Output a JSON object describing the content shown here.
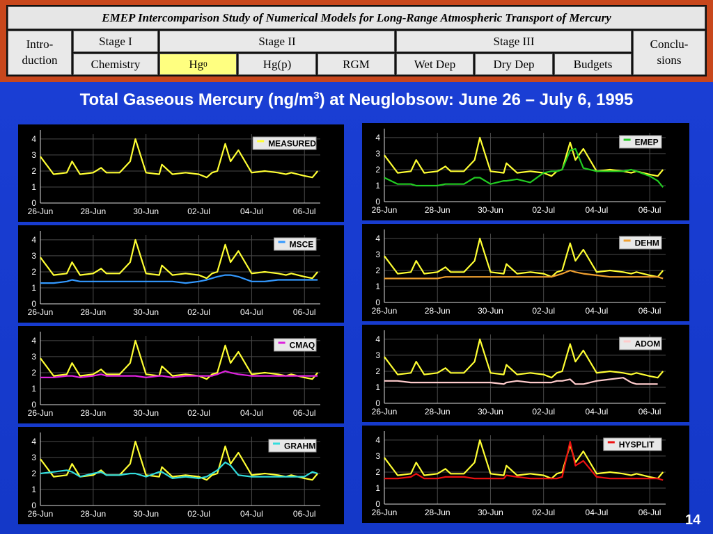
{
  "nav": {
    "title": "EMEP Intercomparison Study of Numerical Models for Long-Range Atmospheric Transport of Mercury",
    "intro": "Intro-\nduction",
    "stage1": "Stage I",
    "stage2": "Stage II",
    "stage3": "Stage III",
    "conclusions": "Conclu-\nsions",
    "chemistry": "Chemistry",
    "hg0_base": "Hg",
    "hg0_sup": "0",
    "hgp": "Hg(p)",
    "rgm": "RGM",
    "wetdep": "Wet Dep",
    "drydep": "Dry Dep",
    "budgets": "Budgets"
  },
  "title": {
    "prefix": "Total Gaseous Mercury (ng/m",
    "sup": "3",
    "suffix": ") at Neuglobsow: June 26 – July 6, 1995"
  },
  "page_number": "14",
  "colors": {
    "measured": "#ffff33",
    "emep": "#22cc22",
    "msce": "#3399ff",
    "dehm": "#f0a030",
    "cmaq": "#dd22dd",
    "adom": "#ffcccc",
    "grahm": "#33dddd",
    "hysplit": "#ee1111",
    "nav_active": "#ffff80",
    "background": "#1b3fd6"
  },
  "chart_data": [
    {
      "type": "line",
      "title": "",
      "x_tick_labels": [
        "26-Jun",
        "28-Jun",
        "30-Jun",
        "02-Jul",
        "04-Jul",
        "06-Jul"
      ],
      "x": [
        26.0,
        26.5,
        27.0,
        27.2,
        27.5,
        28.0,
        28.3,
        28.5,
        29.0,
        29.4,
        29.6,
        30.0,
        30.5,
        30.6,
        31.0,
        31.5,
        32.0,
        32.3,
        32.5,
        32.7,
        33.0,
        33.2,
        33.5,
        34.0,
        34.5,
        35.0,
        35.3,
        35.5,
        36.0,
        36.3,
        36.5
      ],
      "y_ticks": [
        0,
        1,
        2,
        3,
        4
      ],
      "ylim": [
        0,
        4.3
      ],
      "grid": true,
      "legend_position": "top-right",
      "series": [
        {
          "name": "MEASURED",
          "color_key": "measured",
          "values": [
            2.9,
            1.8,
            1.9,
            2.6,
            1.8,
            1.9,
            2.2,
            1.9,
            1.9,
            2.6,
            4.0,
            1.9,
            1.8,
            2.4,
            1.8,
            1.9,
            1.8,
            1.6,
            1.9,
            2.0,
            3.7,
            2.6,
            3.3,
            1.9,
            2.0,
            1.9,
            1.8,
            1.9,
            1.7,
            1.6,
            2.0
          ]
        }
      ]
    },
    {
      "type": "line",
      "title": "",
      "x_tick_labels": [
        "26-Jun",
        "28-Jun",
        "30-Jun",
        "02-Jul",
        "04-Jul",
        "06-Jul"
      ],
      "x": [
        26.0,
        26.5,
        27.0,
        27.2,
        27.5,
        28.0,
        28.3,
        28.5,
        29.0,
        29.4,
        29.6,
        30.0,
        30.5,
        30.6,
        31.0,
        31.5,
        32.0,
        32.3,
        32.5,
        32.7,
        33.0,
        33.2,
        33.5,
        34.0,
        34.5,
        35.0,
        35.3,
        35.5,
        36.0,
        36.3,
        36.5
      ],
      "y_ticks": [
        0,
        1,
        2,
        3,
        4
      ],
      "ylim": [
        0,
        4.3
      ],
      "grid": true,
      "legend_position": "top-right",
      "series": [
        {
          "name": "MEASURED",
          "color_key": "measured",
          "values": [
            2.9,
            1.8,
            1.9,
            2.6,
            1.8,
            1.9,
            2.2,
            1.9,
            1.9,
            2.6,
            4.0,
            1.9,
            1.8,
            2.4,
            1.8,
            1.9,
            1.8,
            1.6,
            1.9,
            2.0,
            3.7,
            2.6,
            3.3,
            1.9,
            2.0,
            1.9,
            1.8,
            1.9,
            1.7,
            1.6,
            2.0
          ]
        },
        {
          "name": "EMEP",
          "color_key": "emep",
          "values": [
            1.5,
            1.1,
            1.1,
            1.0,
            1.0,
            1.0,
            1.1,
            1.1,
            1.1,
            1.5,
            1.5,
            1.1,
            1.3,
            1.3,
            1.4,
            1.2,
            1.8,
            1.9,
            1.9,
            2.0,
            3.2,
            3.3,
            2.1,
            1.9,
            1.9,
            1.9,
            2.0,
            1.9,
            1.6,
            1.3,
            0.9
          ]
        }
      ]
    },
    {
      "type": "line",
      "title": "",
      "x_tick_labels": [
        "26-Jun",
        "28-Jun",
        "30-Jun",
        "02-Jul",
        "04-Jul",
        "06-Jul"
      ],
      "x": [
        26.0,
        26.5,
        27.0,
        27.2,
        27.5,
        28.0,
        28.3,
        28.5,
        29.0,
        29.4,
        29.6,
        30.0,
        30.5,
        30.6,
        31.0,
        31.5,
        32.0,
        32.3,
        32.5,
        32.7,
        33.0,
        33.2,
        33.5,
        34.0,
        34.5,
        35.0,
        35.3,
        35.5,
        36.0,
        36.3,
        36.5
      ],
      "y_ticks": [
        0,
        1,
        2,
        3,
        4
      ],
      "ylim": [
        0,
        4.3
      ],
      "grid": true,
      "legend_position": "top-right",
      "series": [
        {
          "name": "MEASURED",
          "color_key": "measured",
          "values": [
            2.9,
            1.8,
            1.9,
            2.6,
            1.8,
            1.9,
            2.2,
            1.9,
            1.9,
            2.6,
            4.0,
            1.9,
            1.8,
            2.4,
            1.8,
            1.9,
            1.8,
            1.6,
            1.9,
            2.0,
            3.7,
            2.6,
            3.3,
            1.9,
            2.0,
            1.9,
            1.8,
            1.9,
            1.7,
            1.6,
            2.0
          ]
        },
        {
          "name": "MSCE",
          "color_key": "msce",
          "values": [
            1.3,
            1.3,
            1.4,
            1.5,
            1.4,
            1.4,
            1.4,
            1.4,
            1.4,
            1.4,
            1.4,
            1.4,
            1.4,
            1.4,
            1.4,
            1.3,
            1.4,
            1.5,
            1.6,
            1.7,
            1.8,
            1.8,
            1.7,
            1.4,
            1.4,
            1.5,
            1.5,
            1.5,
            1.5,
            1.5,
            1.5
          ]
        }
      ]
    },
    {
      "type": "line",
      "title": "",
      "x_tick_labels": [
        "26-Jun",
        "28-Jun",
        "30-Jun",
        "02-Jul",
        "04-Jul",
        "06-Jul"
      ],
      "x": [
        26.0,
        26.5,
        27.0,
        27.2,
        27.5,
        28.0,
        28.3,
        28.5,
        29.0,
        29.4,
        29.6,
        30.0,
        30.5,
        30.6,
        31.0,
        31.5,
        32.0,
        32.3,
        32.5,
        32.7,
        33.0,
        33.2,
        33.5,
        34.0,
        34.5,
        35.0,
        35.3,
        35.5,
        36.0,
        36.3,
        36.5
      ],
      "y_ticks": [
        0,
        1,
        2,
        3,
        4
      ],
      "ylim": [
        0,
        4.3
      ],
      "grid": true,
      "legend_position": "top-right",
      "series": [
        {
          "name": "MEASURED",
          "color_key": "measured",
          "values": [
            2.9,
            1.8,
            1.9,
            2.6,
            1.8,
            1.9,
            2.2,
            1.9,
            1.9,
            2.6,
            4.0,
            1.9,
            1.8,
            2.4,
            1.8,
            1.9,
            1.8,
            1.6,
            1.9,
            2.0,
            3.7,
            2.6,
            3.3,
            1.9,
            2.0,
            1.9,
            1.8,
            1.9,
            1.7,
            1.6,
            2.0
          ]
        },
        {
          "name": "DEHM",
          "color_key": "dehm",
          "values": [
            1.5,
            1.5,
            1.5,
            1.5,
            1.5,
            1.5,
            1.6,
            1.6,
            1.6,
            1.6,
            1.6,
            1.6,
            1.6,
            1.6,
            1.6,
            1.6,
            1.6,
            1.6,
            1.7,
            1.8,
            2.0,
            1.9,
            1.8,
            1.7,
            1.6,
            1.6,
            1.6,
            1.6,
            1.6,
            1.6,
            1.5
          ]
        }
      ]
    },
    {
      "type": "line",
      "title": "",
      "x_tick_labels": [
        "26-Jun",
        "28-Jun",
        "30-Jun",
        "02-Jul",
        "04-Jul",
        "06-Jul"
      ],
      "x": [
        26.0,
        26.5,
        27.0,
        27.2,
        27.5,
        28.0,
        28.3,
        28.5,
        29.0,
        29.4,
        29.6,
        30.0,
        30.5,
        30.6,
        31.0,
        31.5,
        32.0,
        32.3,
        32.5,
        32.7,
        33.0,
        33.2,
        33.5,
        34.0,
        34.5,
        35.0,
        35.3,
        35.5,
        36.0,
        36.3,
        36.5
      ],
      "y_ticks": [
        0,
        1,
        2,
        3,
        4
      ],
      "ylim": [
        0,
        4.3
      ],
      "grid": true,
      "legend_position": "top-right",
      "series": [
        {
          "name": "MEASURED",
          "color_key": "measured",
          "values": [
            2.9,
            1.8,
            1.9,
            2.6,
            1.8,
            1.9,
            2.2,
            1.9,
            1.9,
            2.6,
            4.0,
            1.9,
            1.8,
            2.4,
            1.8,
            1.9,
            1.8,
            1.6,
            1.9,
            2.0,
            3.7,
            2.6,
            3.3,
            1.9,
            2.0,
            1.9,
            1.8,
            1.9,
            1.7,
            1.6,
            2.0
          ]
        },
        {
          "name": "CMAQ",
          "color_key": "cmaq",
          "values": [
            1.7,
            1.7,
            1.8,
            1.8,
            1.7,
            1.8,
            1.9,
            1.8,
            1.8,
            1.8,
            1.8,
            1.7,
            1.8,
            1.8,
            1.7,
            1.8,
            1.8,
            1.8,
            1.8,
            1.9,
            2.1,
            2.0,
            1.9,
            1.8,
            1.8,
            1.8,
            1.8,
            1.8,
            1.8,
            1.8,
            1.8
          ]
        }
      ]
    },
    {
      "type": "line",
      "title": "",
      "x_tick_labels": [
        "26-Jun",
        "28-Jun",
        "30-Jun",
        "02-Jul",
        "04-Jul",
        "06-Jul"
      ],
      "x": [
        26.0,
        26.5,
        27.0,
        27.2,
        27.5,
        28.0,
        28.3,
        28.5,
        29.0,
        29.4,
        29.6,
        30.0,
        30.5,
        30.6,
        31.0,
        31.5,
        32.0,
        32.3,
        32.5,
        32.7,
        33.0,
        33.2,
        33.5,
        34.0,
        34.5,
        35.0,
        35.3,
        35.5,
        36.0,
        36.3,
        36.5
      ],
      "y_ticks": [
        0,
        1,
        2,
        3,
        4
      ],
      "ylim": [
        0,
        4.3
      ],
      "grid": true,
      "legend_position": "top-right",
      "series": [
        {
          "name": "MEASURED",
          "color_key": "measured",
          "values": [
            2.9,
            1.8,
            1.9,
            2.6,
            1.8,
            1.9,
            2.2,
            1.9,
            1.9,
            2.6,
            4.0,
            1.9,
            1.8,
            2.4,
            1.8,
            1.9,
            1.8,
            1.6,
            1.9,
            2.0,
            3.7,
            2.6,
            3.3,
            1.9,
            2.0,
            1.9,
            1.8,
            1.9,
            1.7,
            1.6,
            2.0
          ]
        },
        {
          "name": "ADOM",
          "color_key": "adom",
          "values": [
            1.4,
            1.4,
            1.3,
            1.3,
            1.3,
            1.3,
            1.3,
            1.3,
            1.3,
            1.3,
            1.3,
            1.3,
            1.2,
            1.3,
            1.4,
            1.3,
            1.3,
            1.3,
            1.4,
            1.4,
            1.5,
            1.2,
            1.2,
            1.4,
            1.5,
            1.6,
            1.3,
            1.2,
            1.2,
            1.2,
            null
          ]
        }
      ]
    },
    {
      "type": "line",
      "title": "",
      "x_tick_labels": [
        "26-Jun",
        "28-Jun",
        "30-Jun",
        "02-Jul",
        "04-Jul",
        "06-Jul"
      ],
      "x": [
        26.0,
        26.5,
        27.0,
        27.2,
        27.5,
        28.0,
        28.3,
        28.5,
        29.0,
        29.4,
        29.6,
        30.0,
        30.5,
        30.6,
        31.0,
        31.5,
        32.0,
        32.3,
        32.5,
        32.7,
        33.0,
        33.2,
        33.5,
        34.0,
        34.5,
        35.0,
        35.3,
        35.5,
        36.0,
        36.3,
        36.5
      ],
      "y_ticks": [
        0,
        1,
        2,
        3,
        4
      ],
      "ylim": [
        0,
        4.3
      ],
      "grid": true,
      "legend_position": "top-right",
      "series": [
        {
          "name": "MEASURED",
          "color_key": "measured",
          "values": [
            2.9,
            1.8,
            1.9,
            2.6,
            1.8,
            1.9,
            2.2,
            1.9,
            1.9,
            2.6,
            4.0,
            1.9,
            1.8,
            2.4,
            1.8,
            1.9,
            1.8,
            1.6,
            1.9,
            2.0,
            3.7,
            2.6,
            3.3,
            1.9,
            2.0,
            1.9,
            1.8,
            1.9,
            1.7,
            1.6,
            2.0
          ]
        },
        {
          "name": "GRAHM",
          "color_key": "grahm",
          "values": [
            2.0,
            2.1,
            2.2,
            2.1,
            1.8,
            2.0,
            2.1,
            1.9,
            1.9,
            2.0,
            2.0,
            1.8,
            2.1,
            2.1,
            1.7,
            1.8,
            1.7,
            1.8,
            2.0,
            2.2,
            2.7,
            2.5,
            1.9,
            1.8,
            1.8,
            1.8,
            1.8,
            1.8,
            1.8,
            2.1,
            2.0
          ]
        }
      ]
    },
    {
      "type": "line",
      "title": "",
      "x_tick_labels": [
        "26-Jun",
        "28-Jun",
        "30-Jun",
        "02-Jul",
        "04-Jul",
        "06-Jul"
      ],
      "x": [
        26.0,
        26.5,
        27.0,
        27.2,
        27.5,
        28.0,
        28.3,
        28.5,
        29.0,
        29.4,
        29.6,
        30.0,
        30.5,
        30.6,
        31.0,
        31.5,
        32.0,
        32.3,
        32.5,
        32.7,
        33.0,
        33.2,
        33.5,
        34.0,
        34.5,
        35.0,
        35.3,
        35.5,
        36.0,
        36.3,
        36.5
      ],
      "y_ticks": [
        0,
        1,
        2,
        3,
        4
      ],
      "ylim": [
        0,
        4.3
      ],
      "grid": true,
      "legend_position": "top-right",
      "series": [
        {
          "name": "MEASURED",
          "color_key": "measured",
          "values": [
            2.9,
            1.8,
            1.9,
            2.6,
            1.8,
            1.9,
            2.2,
            1.9,
            1.9,
            2.6,
            4.0,
            1.9,
            1.8,
            2.4,
            1.8,
            1.9,
            1.8,
            1.6,
            1.9,
            2.0,
            3.7,
            2.6,
            3.3,
            1.9,
            2.0,
            1.9,
            1.8,
            1.9,
            1.7,
            1.6,
            2.0
          ]
        },
        {
          "name": "HYSPLIT",
          "color_key": "hysplit",
          "values": [
            1.6,
            1.6,
            1.7,
            1.9,
            1.6,
            1.6,
            1.7,
            1.7,
            1.7,
            1.6,
            1.6,
            1.6,
            1.6,
            1.8,
            1.7,
            1.6,
            1.6,
            1.6,
            1.6,
            1.7,
            3.9,
            2.4,
            2.7,
            1.7,
            1.6,
            1.6,
            1.6,
            1.6,
            1.6,
            1.6,
            1.5
          ]
        }
      ]
    }
  ]
}
